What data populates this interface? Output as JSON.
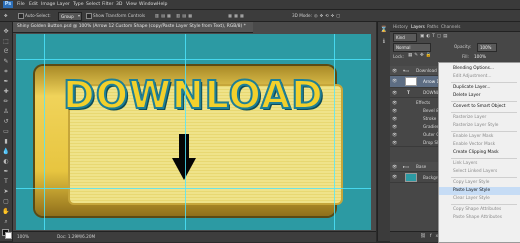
{
  "app": {
    "logo": "Ps"
  },
  "menu": [
    "File",
    "Edit",
    "Image",
    "Layer",
    "Type",
    "Select",
    "Filter",
    "3D",
    "View",
    "Window",
    "Help"
  ],
  "options": {
    "auto_select_label": "Auto-Select:",
    "auto_select_value": "Group",
    "show_transform_label": "Show Transform Controls",
    "mode_label": "3D Mode:"
  },
  "document": {
    "tab_title": "Shiny Golden Button.psd @ 100% (Arrow 12 Custom Shape (copy/Paste Layer Style from Text), RGB/8) *",
    "button_text": "DOWNLOAD",
    "zoom": "100%",
    "doc_info": "Doc: 1.29M/6.20M"
  },
  "panels": {
    "tabs": [
      "History",
      "Layers",
      "Paths",
      "Channels"
    ],
    "kind_label": "Kind",
    "blend_mode": "Normal",
    "opacity_label": "Opacity:",
    "opacity_value": "100%",
    "lock_label": "Lock:",
    "fill_label": "Fill:",
    "fill_value": "100%",
    "layers": [
      {
        "name": "Download",
        "type": "group"
      },
      {
        "name": "Arrow 12 Custom S...",
        "type": "shape",
        "selected": true
      },
      {
        "name": "DOWNLOAD",
        "type": "text"
      },
      {
        "name": "Effects",
        "type": "effects"
      },
      {
        "name": "Bevel & Emboss",
        "type": "effect"
      },
      {
        "name": "Stroke",
        "type": "effect"
      },
      {
        "name": "Gradient Overlay",
        "type": "effect"
      },
      {
        "name": "Outer Glow",
        "type": "effect"
      },
      {
        "name": "Drop Shadow",
        "type": "effect"
      },
      {
        "name": "Base",
        "type": "group"
      },
      {
        "name": "Background",
        "type": "pixel"
      }
    ]
  },
  "context_menu": [
    {
      "label": "Blending Options...",
      "enabled": true
    },
    {
      "label": "Edit Adjustment...",
      "enabled": false
    },
    {
      "sep": true
    },
    {
      "label": "Duplicate Layer...",
      "enabled": true
    },
    {
      "label": "Delete Layer",
      "enabled": true
    },
    {
      "sep": true
    },
    {
      "label": "Convert to Smart Object",
      "enabled": true
    },
    {
      "sep": true
    },
    {
      "label": "Rasterize Layer",
      "enabled": false
    },
    {
      "label": "Rasterize Layer Style",
      "enabled": false
    },
    {
      "sep": true
    },
    {
      "label": "Enable Layer Mask",
      "enabled": false
    },
    {
      "label": "Enable Vector Mask",
      "enabled": false
    },
    {
      "label": "Create Clipping Mask",
      "enabled": true
    },
    {
      "sep": true
    },
    {
      "label": "Link Layers",
      "enabled": false
    },
    {
      "label": "Select Linked Layers",
      "enabled": false
    },
    {
      "sep": true
    },
    {
      "label": "Copy Layer Style",
      "enabled": false
    },
    {
      "label": "Paste Layer Style",
      "enabled": true,
      "highlighted": true
    },
    {
      "label": "Clear Layer Style",
      "enabled": false
    },
    {
      "sep": true
    },
    {
      "label": "Copy Shape Attributes",
      "enabled": false
    },
    {
      "label": "Paste Shape Attributes",
      "enabled": false
    }
  ],
  "colors": {
    "canvas_bg": "#2c9aa3",
    "gold": "#f2d02c",
    "text_stroke": "#1e7f95",
    "menu_highlight": "#c6dcf5"
  }
}
